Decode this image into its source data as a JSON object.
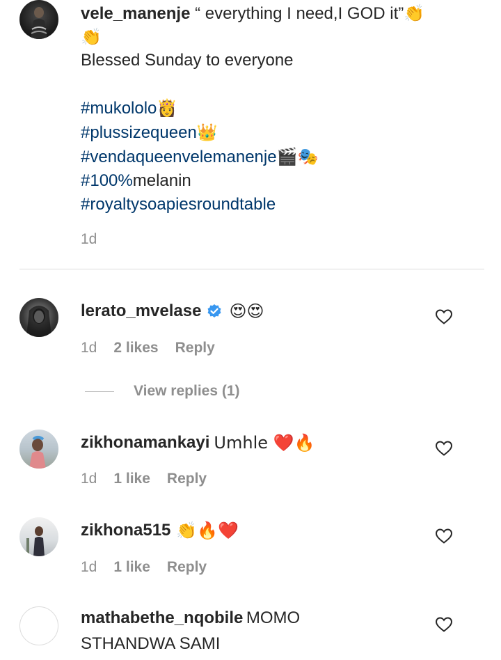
{
  "caption": {
    "username": "vele_manenje",
    "quote": "“ everything I need,I GOD it”",
    "clap": "👏",
    "line2": "Blessed Sunday to everyone",
    "hashtags": [
      {
        "tag": "#mukololo",
        "emoji": "👸"
      },
      {
        "tag": "#plussizequeen",
        "emoji": "👑"
      },
      {
        "tag": "#vendaqueenvelemanenje",
        "emoji": "🎬🎭"
      },
      {
        "tag": "#100%",
        "suffix": "melanin"
      },
      {
        "tag": "#royaltysoapiesroundtable"
      }
    ],
    "time": "1d"
  },
  "comments": [
    {
      "username": "lerato_mvelase",
      "verified": true,
      "text": "😍😍",
      "time": "1d",
      "likes": "2 likes",
      "reply": "Reply",
      "view_replies": "View replies (1)"
    },
    {
      "username": "zikhonamankayi",
      "text": "Umhle ❤️🔥",
      "time": "1d",
      "likes": "1 like",
      "reply": "Reply"
    },
    {
      "username": "zikhona515",
      "text": "👏🔥❤️",
      "time": "1d",
      "likes": "1 like",
      "reply": "Reply"
    },
    {
      "username": "mathabethe_nqobile",
      "text_line1": "MOMO",
      "text_line2": "STHANDWA SAMI"
    }
  ],
  "colors": {
    "text": "#262626",
    "muted": "#8e8e8e",
    "hashtag": "#00376b",
    "verified": "#3897f0",
    "divider": "#dbdbdb"
  }
}
